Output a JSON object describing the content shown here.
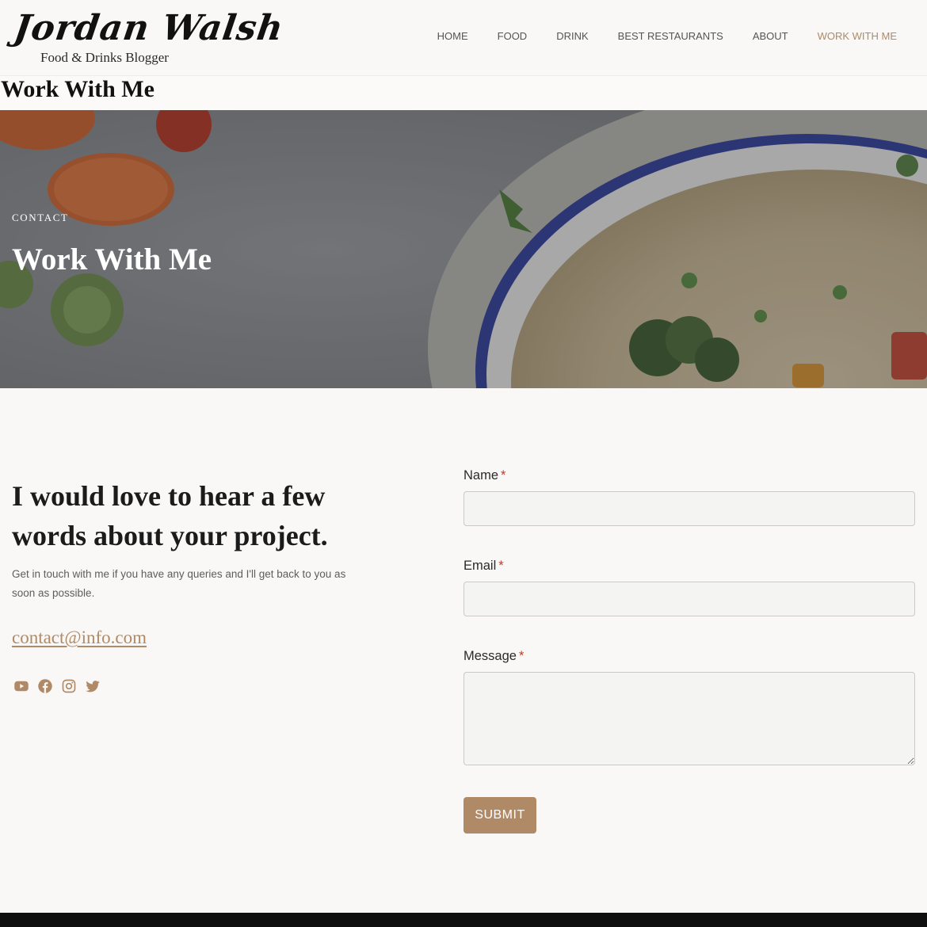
{
  "brand": {
    "name": "Jordan Walsh",
    "tagline": "Food & Drinks Blogger"
  },
  "nav": {
    "items": [
      "HOME",
      "FOOD",
      "DRINK",
      "BEST RESTAURANTS",
      "ABOUT",
      "WORK WITH ME"
    ],
    "active": "WORK WITH ME"
  },
  "page": {
    "title": "Work With Me"
  },
  "hero": {
    "eyebrow": "CONTACT",
    "title": "Work With Me"
  },
  "intro": {
    "heading": "I would love to hear a few words about your project.",
    "text": "Get in touch with me if you have any queries and I'll get back to you as soon as possible.",
    "email": "contact@info.com"
  },
  "socials": [
    "youtube-icon",
    "facebook-icon",
    "instagram-icon",
    "twitter-icon"
  ],
  "form": {
    "name_label": "Name",
    "email_label": "Email",
    "message_label": "Message",
    "required_mark": "*",
    "name_value": "",
    "email_value": "",
    "message_value": "",
    "submit_label": "SUBMIT"
  },
  "colors": {
    "accent": "#b08a66",
    "background": "#f9f8f6",
    "footer": "#0f0f0f",
    "required": "#c0392b"
  }
}
